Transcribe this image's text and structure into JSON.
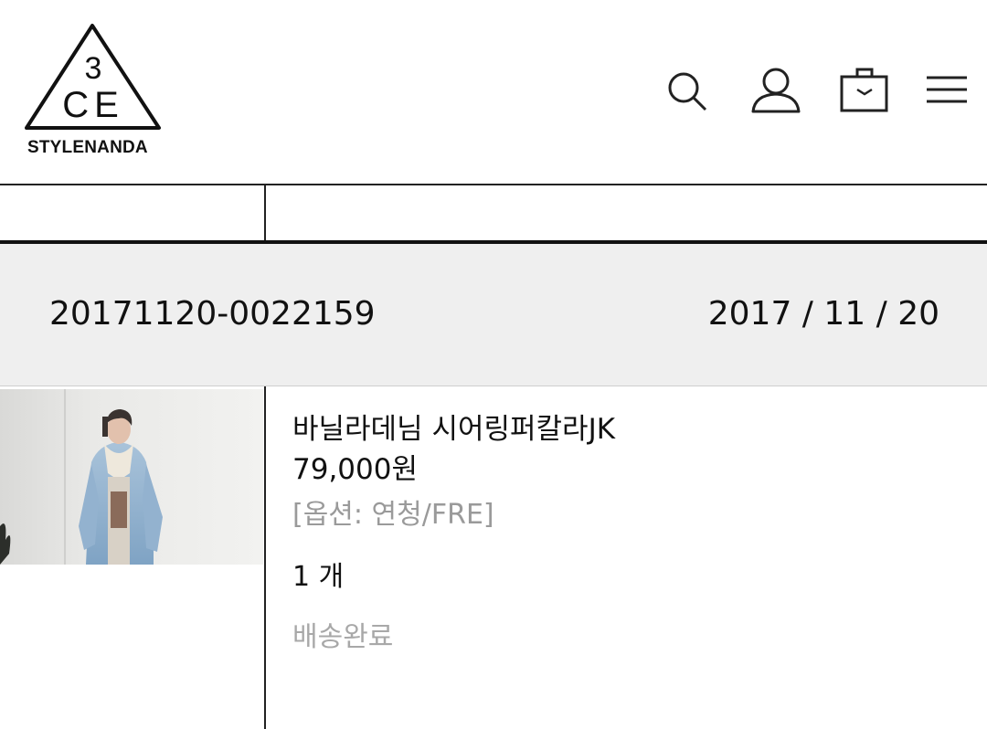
{
  "brand": {
    "logo_mark": "3CE",
    "logo_text": "STYLENANDA"
  },
  "header_icons": [
    "search-icon",
    "user-icon",
    "shopping-bag-icon",
    "menu-icon"
  ],
  "order": {
    "number": "20171120-0022159",
    "date": "2017 / 11 / 20"
  },
  "product": {
    "name": "바닐라데님 시어링퍼칼라JK",
    "price": "79,000원",
    "option": "[옵션: 연청/FRE]",
    "quantity": "1 개",
    "status": "배송완료"
  },
  "colors": {
    "text": "#111111",
    "muted": "#9a9a9a",
    "band": "#efefef"
  }
}
